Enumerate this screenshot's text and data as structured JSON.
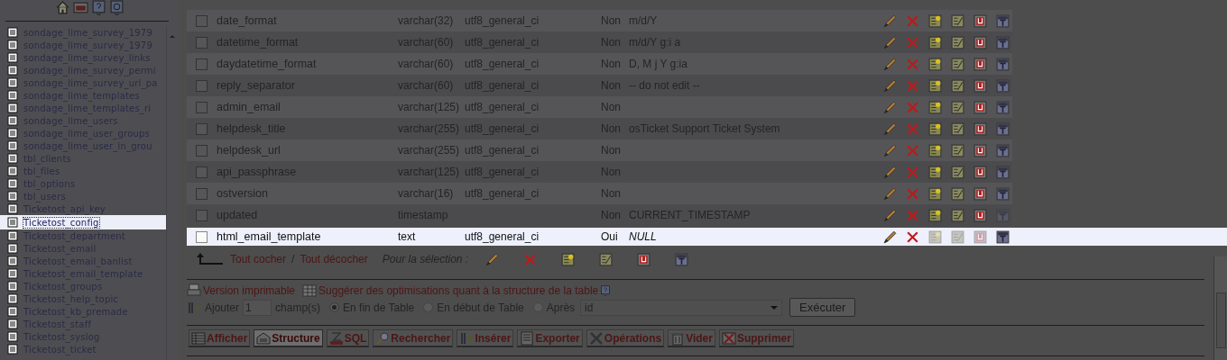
{
  "sidebar": {
    "toolbar": [
      {
        "kind": "home"
      },
      {
        "kind": "sql"
      },
      {
        "kind": "help"
      },
      {
        "kind": "docs"
      }
    ],
    "items": [
      {
        "name": "sondage_lime_survey_1979",
        "selected": false
      },
      {
        "name": "sondage_lime_survey_1979",
        "selected": false
      },
      {
        "name": "sondage_lime_survey_links",
        "selected": false
      },
      {
        "name": "sondage_lime_survey_permi",
        "selected": false
      },
      {
        "name": "sondage_lime_survey_url_pa",
        "selected": false
      },
      {
        "name": "sondage_lime_templates",
        "selected": false
      },
      {
        "name": "sondage_lime_templates_ri",
        "selected": false
      },
      {
        "name": "sondage_lime_users",
        "selected": false
      },
      {
        "name": "sondage_lime_user_groups",
        "selected": false
      },
      {
        "name": "sondage_lime_user_in_grou",
        "selected": false
      },
      {
        "name": "tbl_clients",
        "selected": false
      },
      {
        "name": "tbl_files",
        "selected": false
      },
      {
        "name": "tbl_options",
        "selected": false
      },
      {
        "name": "tbl_users",
        "selected": false
      },
      {
        "name": "Ticketost_api_key",
        "selected": false
      },
      {
        "name": "Ticketost_config",
        "selected": true
      },
      {
        "name": "Ticketost_department",
        "selected": false
      },
      {
        "name": "Ticketost_email",
        "selected": false
      },
      {
        "name": "Ticketost_email_banlist",
        "selected": false
      },
      {
        "name": "Ticketost_email_template",
        "selected": false
      },
      {
        "name": "Ticketost_groups",
        "selected": false
      },
      {
        "name": "Ticketost_help_topic",
        "selected": false
      },
      {
        "name": "Ticketost_kb_premade",
        "selected": false
      },
      {
        "name": "Ticketost_staff",
        "selected": false
      },
      {
        "name": "Ticketost_syslog",
        "selected": false
      },
      {
        "name": "Ticketost_ticket",
        "selected": false
      }
    ]
  },
  "table": {
    "rows": [
      {
        "field": "date_format",
        "type": "varchar(32)",
        "collation": "utf8_general_ci",
        "null": "Non",
        "default": "m/d/Y",
        "checked": false,
        "selected": false,
        "fulltext_disabled": false,
        "text_type": false
      },
      {
        "field": "datetime_format",
        "type": "varchar(60)",
        "collation": "utf8_general_ci",
        "null": "Non",
        "default": "m/d/Y g:i a",
        "checked": false,
        "selected": false,
        "fulltext_disabled": false,
        "text_type": false
      },
      {
        "field": "daydatetime_format",
        "type": "varchar(60)",
        "collation": "utf8_general_ci",
        "null": "Non",
        "default": "D, M j Y g:ia",
        "checked": false,
        "selected": false,
        "fulltext_disabled": false,
        "text_type": false
      },
      {
        "field": "reply_separator",
        "type": "varchar(60)",
        "collation": "utf8_general_ci",
        "null": "Non",
        "default": "-- do not edit --",
        "checked": false,
        "selected": false,
        "fulltext_disabled": false,
        "text_type": false
      },
      {
        "field": "admin_email",
        "type": "varchar(125)",
        "collation": "utf8_general_ci",
        "null": "Non",
        "checked": false,
        "selected": false,
        "fulltext_disabled": false,
        "text_type": false
      },
      {
        "field": "helpdesk_title",
        "type": "varchar(255)",
        "collation": "utf8_general_ci",
        "null": "Non",
        "default": "osTicket Support Ticket System",
        "checked": false,
        "selected": false,
        "fulltext_disabled": false,
        "text_type": false
      },
      {
        "field": "helpdesk_url",
        "type": "varchar(255)",
        "collation": "utf8_general_ci",
        "null": "Non",
        "checked": false,
        "selected": false,
        "fulltext_disabled": false,
        "text_type": false
      },
      {
        "field": "api_passphrase",
        "type": "varchar(125)",
        "collation": "utf8_general_ci",
        "null": "Non",
        "checked": false,
        "selected": false,
        "fulltext_disabled": false,
        "text_type": false
      },
      {
        "field": "ostversion",
        "type": "varchar(16)",
        "collation": "utf8_general_ci",
        "null": "Non",
        "checked": false,
        "selected": false,
        "fulltext_disabled": false,
        "text_type": false
      },
      {
        "field": "updated",
        "type": "timestamp",
        "null": "Non",
        "default": "CURRENT_TIMESTAMP",
        "checked": false,
        "selected": false,
        "fulltext_disabled": true,
        "text_type": false
      },
      {
        "field": "html_email_template",
        "type": "text",
        "collation": "utf8_general_ci",
        "null": "Oui",
        "default": "NULL",
        "null_default": true,
        "checked": false,
        "selected": true,
        "fulltext_disabled": false,
        "text_type": true
      }
    ]
  },
  "selection_bar": {
    "check_all": "Tout cocher",
    "separator": "/",
    "uncheck_all": "Tout décocher",
    "label": "Pour la sélection :"
  },
  "links": [
    {
      "kind": "print",
      "label": "Version imprimable"
    },
    {
      "kind": "propose",
      "label": "Suggérer des optimisations quant à la structure de la table"
    }
  ],
  "add_fields": {
    "label": "Ajouter",
    "count": "1",
    "unit": "champ(s)",
    "positions": [
      {
        "label": "En fin de Table",
        "selected": true
      },
      {
        "label": "En début de Table",
        "selected": false
      },
      {
        "label": "Après",
        "selected": false
      }
    ],
    "after_value": "id",
    "button": "Exécuter"
  },
  "tabs": [
    {
      "kind": "browse",
      "label": "Afficher",
      "selected": false
    },
    {
      "kind": "structure",
      "label": "Structure",
      "selected": true
    },
    {
      "kind": "sql",
      "label": "SQL",
      "selected": false
    },
    {
      "kind": "search",
      "label": "Rechercher",
      "selected": false
    },
    {
      "kind": "insert",
      "label": "Insérer",
      "selected": false
    },
    {
      "kind": "export",
      "label": "Exporter",
      "selected": false
    },
    {
      "kind": "operations",
      "label": "Opérations",
      "selected": false
    },
    {
      "kind": "empty",
      "label": "Vider",
      "selected": false
    },
    {
      "kind": "drop",
      "label": "Supprimer",
      "selected": false
    }
  ]
}
